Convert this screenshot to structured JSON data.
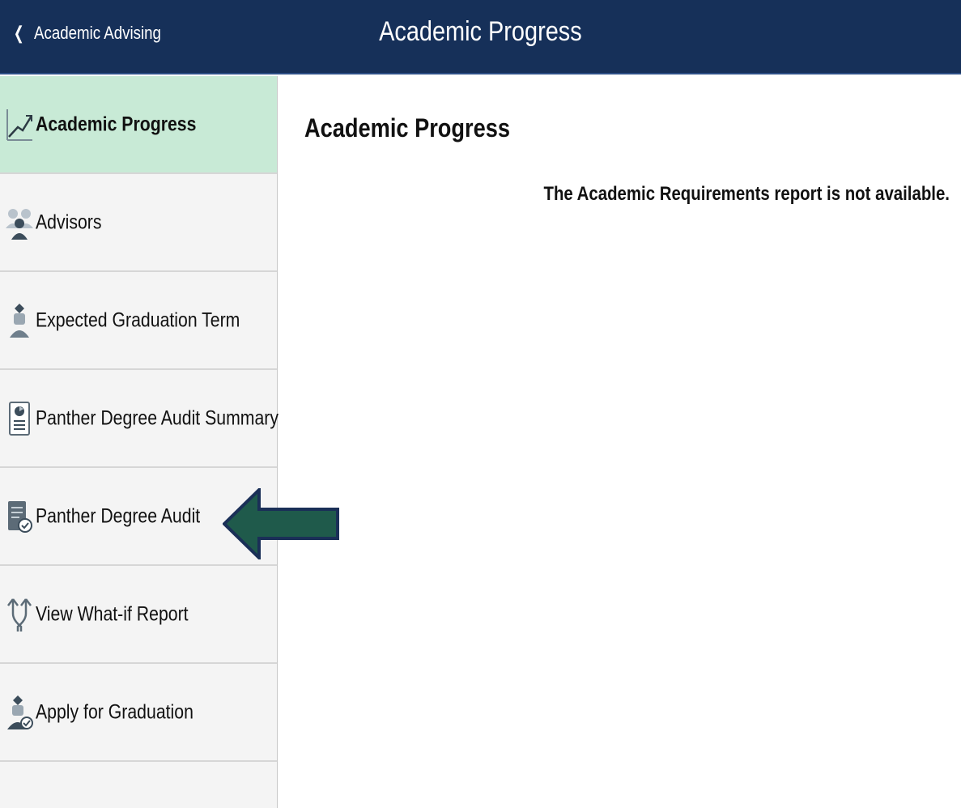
{
  "header": {
    "back_label": "Academic Advising",
    "title": "Academic Progress",
    "back_icon": "chevron-left-icon",
    "background": "#163059"
  },
  "sidebar": {
    "items": [
      {
        "label": "Academic Progress",
        "icon": "line-chart-icon",
        "active": true
      },
      {
        "label": "Advisors",
        "icon": "people-icon",
        "active": false
      },
      {
        "label": "Expected Graduation Term",
        "icon": "graduate-icon",
        "active": false
      },
      {
        "label": "Panther Degree Audit Summary",
        "icon": "document-summary-icon",
        "active": false
      },
      {
        "label": "Panther Degree Audit",
        "icon": "document-check-icon",
        "active": false
      },
      {
        "label": "View What-if Report",
        "icon": "split-arrows-icon",
        "active": false
      },
      {
        "label": "Apply for Graduation",
        "icon": "graduate-check-icon",
        "active": false
      }
    ],
    "active_color": "#c8ead6"
  },
  "main": {
    "title": "Academic Progress",
    "message": "The Academic Requirements report is not available."
  },
  "annotation": {
    "arrow_color": "#1f5a4b"
  }
}
